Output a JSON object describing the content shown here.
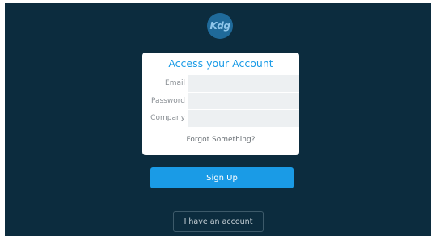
{
  "logo": {
    "text": "Kdg"
  },
  "card": {
    "title": "Access your Account",
    "fields": [
      {
        "label": "Email",
        "value": ""
      },
      {
        "label": "Password",
        "value": ""
      },
      {
        "label": "Company",
        "value": ""
      }
    ],
    "forgot_link": "Forgot Something?"
  },
  "buttons": {
    "signup": "Sign Up",
    "have_account": "I have an account"
  },
  "colors": {
    "background": "#0c2c3e",
    "accent": "#1a9be6",
    "input_fill": "#edf0f2"
  }
}
